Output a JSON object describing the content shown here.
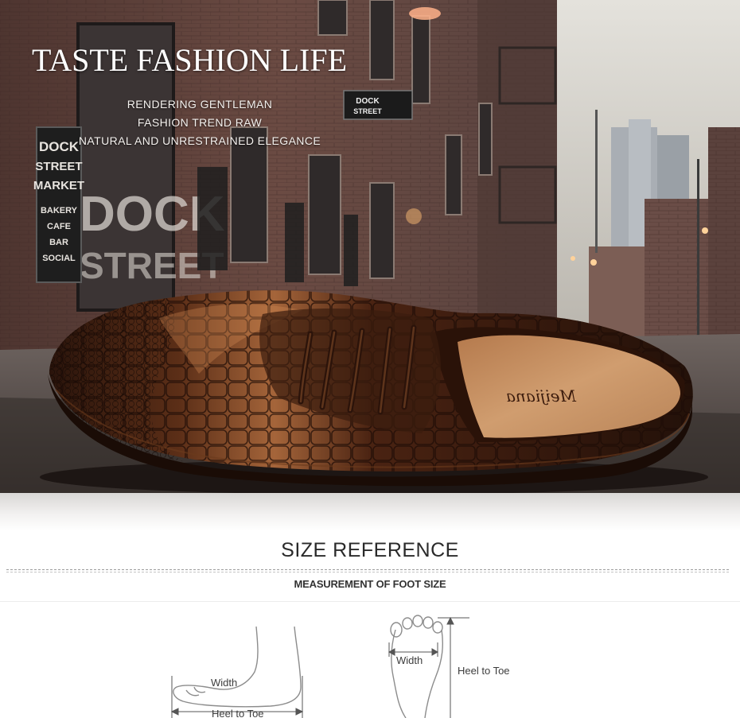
{
  "hero": {
    "title": "TASTE FASHION LIFE",
    "tagline": [
      "RENDERING GENTLEMAN",
      "FASHION TREND RAW",
      "NATURAL AND UNRESTRAINED ELEGANCE"
    ],
    "brand_insole": "Meijiana",
    "street_signs": {
      "hanging_sign": [
        "DOCK",
        "STREET"
      ],
      "chalkboard": [
        "DOCK",
        "STREET",
        "MARKET",
        "BAKERY",
        "CAFE",
        "BAR",
        "SOCIAL"
      ],
      "window_letters": [
        "DOCK",
        "STREET"
      ]
    }
  },
  "size_reference": {
    "title": "SIZE REFERENCE",
    "subtitle": "MEASUREMENT OF FOOT SIZE",
    "side_view": {
      "width_label": "Width",
      "length_label": "Heel to Toe"
    },
    "top_view": {
      "width_label": "Width",
      "length_label": "Heel to Toe"
    }
  },
  "colors": {
    "leather_dark": "#3b1c10",
    "leather_light": "#a7673a",
    "insole": "#c79062",
    "brick": "#6e4a40",
    "text_dark": "#2a2a2a"
  }
}
